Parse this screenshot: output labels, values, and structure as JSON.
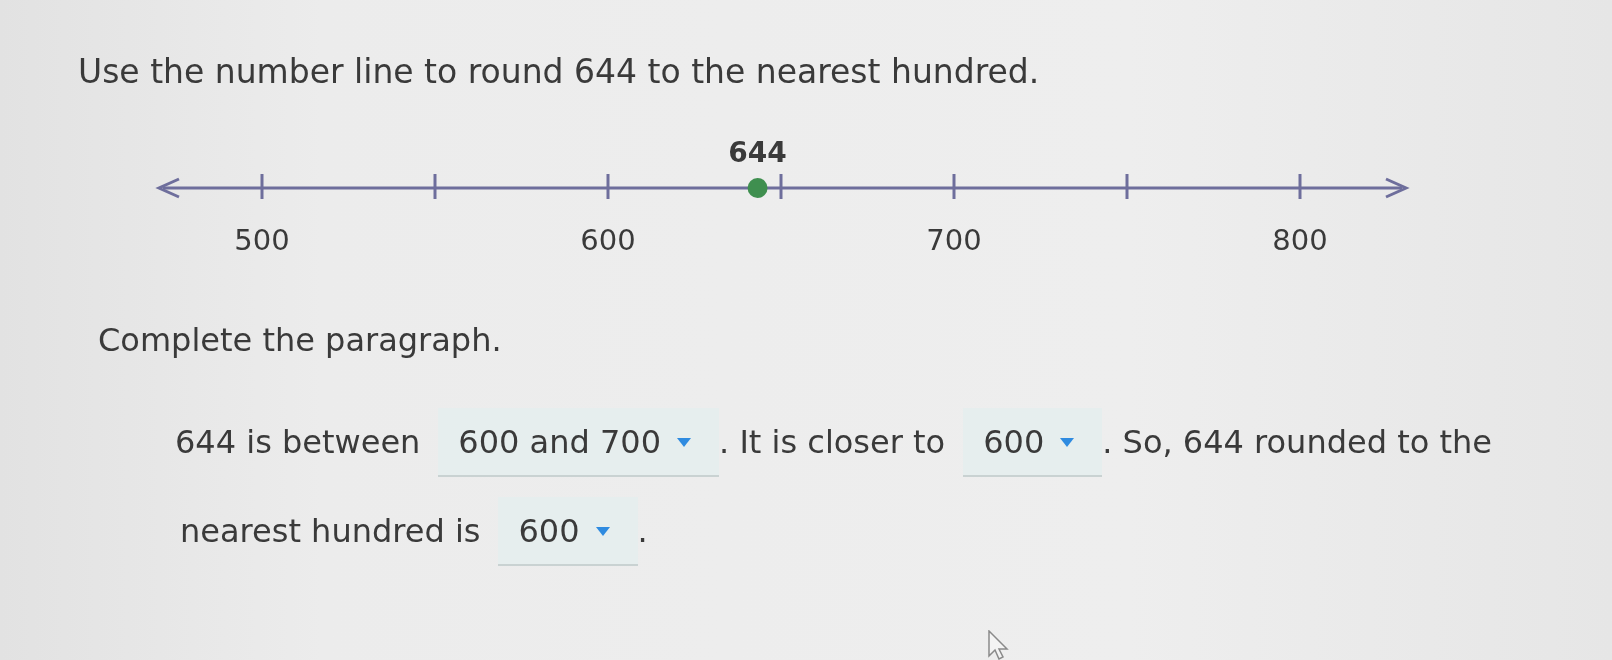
{
  "question": {
    "text": "Use the number line to round 644 to the nearest hundred."
  },
  "number_line": {
    "ticks": [
      {
        "kind": "major",
        "label": "500"
      },
      {
        "kind": "minor"
      },
      {
        "kind": "major",
        "label": "600"
      },
      {
        "kind": "minor"
      },
      {
        "kind": "major",
        "label": "700"
      },
      {
        "kind": "minor"
      },
      {
        "kind": "major",
        "label": "800"
      }
    ],
    "point": {
      "label": "644",
      "level": 0.48
    }
  },
  "instruction": {
    "text": "Complete the paragraph."
  },
  "paragraph": {
    "lines": [
      [
        {
          "kind": "text",
          "text": "644 is between"
        },
        {
          "kind": "dropdown",
          "value": "600 and 700"
        },
        {
          "kind": "text",
          "text": ". It is closer to"
        },
        {
          "kind": "dropdown",
          "value": "600"
        },
        {
          "kind": "text",
          "text": ". So, 644 rounded to the"
        }
      ],
      [
        {
          "kind": "text",
          "text": "nearest hundred is"
        },
        {
          "kind": "dropdown",
          "value": "600"
        },
        {
          "kind": "text",
          "text": "."
        }
      ]
    ]
  }
}
